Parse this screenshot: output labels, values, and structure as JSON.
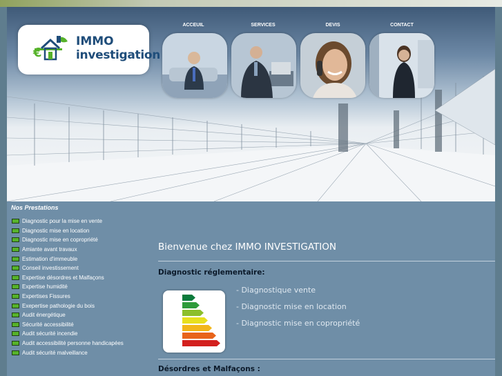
{
  "brand": {
    "name_top": "IMMO",
    "name_bottom": "investigation"
  },
  "nav": [
    "ACCEUIL",
    "SERVICES",
    "DEVIS",
    "CONTACT"
  ],
  "sidebar": {
    "title": "Nos Prestations",
    "items": [
      "Diagnostic pour la mise en vente",
      "Diagnostic mise en location",
      "Diagnostic mise en copropriété",
      "Amiante avant travaux",
      "Estimation d'immeuble",
      "Conseil investissement",
      "Expertise désordres et Malfaçons",
      "Expertise humidité",
      "Expertises Fissures",
      "Exepertise pathologie du bois",
      "Audit énergétique",
      "Sécurité accessibilité",
      "Audit sécurité incendie",
      "Audit accessibilité personne handicapées",
      "Audit sécurité malveillance"
    ]
  },
  "main": {
    "welcome": "Bienvenue chez IMMO INVESTIGATION",
    "section1_title": "Diagnostic réglementaire:",
    "section1_items": [
      "- Diagnostique vente",
      "- Diagnostic mise en location",
      "- Diagnostic mise en copropriété"
    ],
    "section2_title": "Désordres et Malfaçons :"
  },
  "colors": {
    "page_bg": "#6f8ea7",
    "accent_green": "#56b22a",
    "brand_blue": "#1f4d7a"
  },
  "icons": [
    "house-logo-icon",
    "energy-rating-icon",
    "bullet-icon"
  ]
}
